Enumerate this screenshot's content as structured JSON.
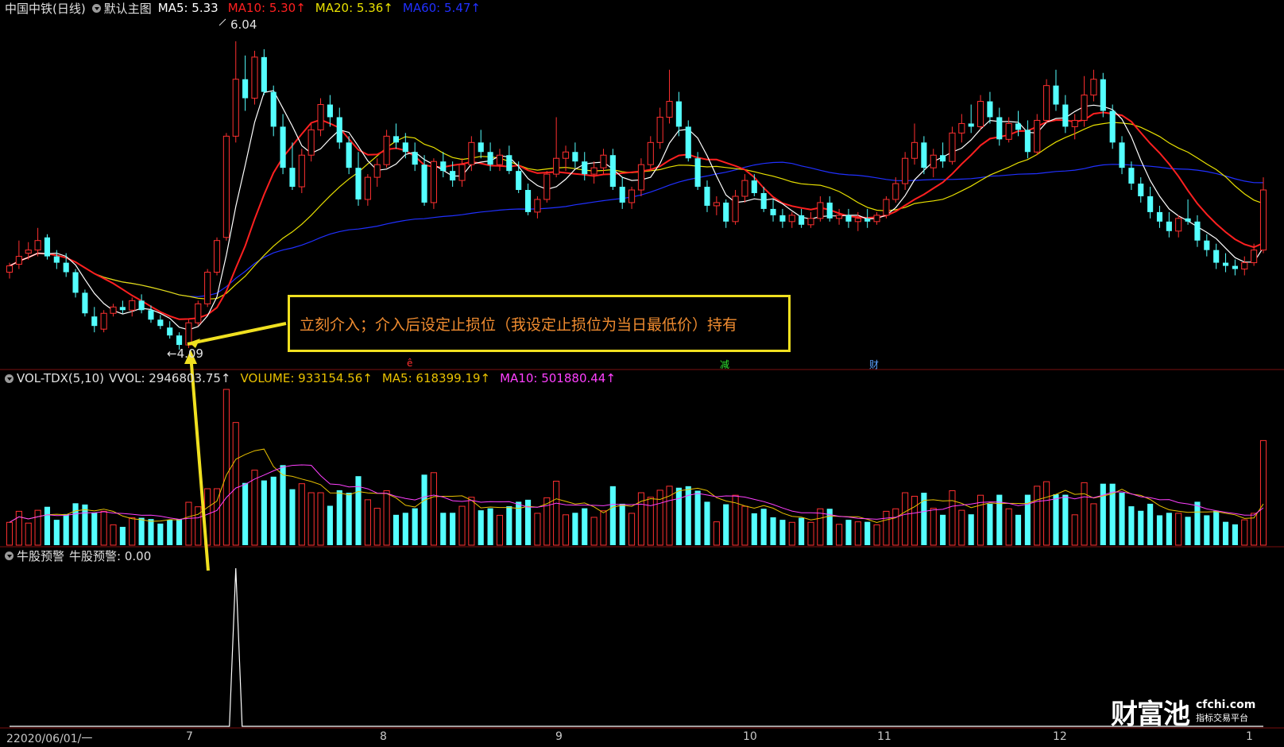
{
  "price_panel": {
    "stock_name": "中国中铁(日线)",
    "template_label": "默认主图",
    "ma5": "MA5: 5.33",
    "ma10": "MA10: 5.30↑",
    "ma20": "MA20: 5.36↑",
    "ma60": "MA60: 5.47↑",
    "high_label": "6.04",
    "low_label": "←4.09",
    "events": [
      "ê",
      "减",
      "财"
    ],
    "colors": {
      "ma5": "#ffffff",
      "ma10": "#ff2020",
      "ma20": "#e8e000",
      "ma60": "#2030ff",
      "up": "#ff3030",
      "down": "#54ffff"
    }
  },
  "callout": {
    "text": "立刻介入；介入后设定止损位（我设定止损位为当日最低价）持有",
    "border_color": "#f0e020",
    "text_color": "#f08c30"
  },
  "volume_panel": {
    "indicator": "VOL-TDX(5,10)",
    "vvol": "VVOL: 2946803.75↑",
    "volume": "VOLUME: 933154.56↑",
    "ma5": "MA5: 618399.19↑",
    "ma10": "MA10: 501880.44↑",
    "colors": {
      "vvol": "#ff3030",
      "volume": "#e8c000",
      "ma5": "#e8c000",
      "ma10": "#ff40ff"
    }
  },
  "signal_panel": {
    "indicator": "牛股预警",
    "value_label": "牛股预警: 0.00"
  },
  "x_axis": {
    "start_label": "22020/06/01/一",
    "month_ticks": [
      "7",
      "8",
      "9",
      "10",
      "11",
      "12",
      "1"
    ]
  },
  "brand": {
    "main": "财富池",
    "site": "cfchi.com",
    "tagline": "指标交易平台"
  },
  "chart_data": {
    "type": "candlestick",
    "title": "中国中铁(日线)",
    "x_ticks": [
      "7",
      "8",
      "9",
      "10",
      "11",
      "12",
      "1"
    ],
    "high": 6.04,
    "low": 4.09,
    "ohlc": [
      [
        4.58,
        4.64,
        4.54,
        4.62
      ],
      [
        4.63,
        4.78,
        4.6,
        4.68
      ],
      [
        4.7,
        4.77,
        4.66,
        4.72
      ],
      [
        4.72,
        4.86,
        4.68,
        4.78
      ],
      [
        4.8,
        4.82,
        4.66,
        4.68
      ],
      [
        4.68,
        4.72,
        4.6,
        4.64
      ],
      [
        4.64,
        4.7,
        4.55,
        4.58
      ],
      [
        4.58,
        4.6,
        4.42,
        4.45
      ],
      [
        4.45,
        4.47,
        4.3,
        4.32
      ],
      [
        4.3,
        4.36,
        4.2,
        4.24
      ],
      [
        4.22,
        4.34,
        4.2,
        4.32
      ],
      [
        4.32,
        4.38,
        4.3,
        4.36
      ],
      [
        4.36,
        4.4,
        4.32,
        4.34
      ],
      [
        4.34,
        4.42,
        4.3,
        4.4
      ],
      [
        4.4,
        4.44,
        4.32,
        4.34
      ],
      [
        4.34,
        4.37,
        4.26,
        4.28
      ],
      [
        4.28,
        4.31,
        4.22,
        4.24
      ],
      [
        4.23,
        4.27,
        4.16,
        4.18
      ],
      [
        4.18,
        4.2,
        4.09,
        4.12
      ],
      [
        4.12,
        4.28,
        4.1,
        4.26
      ],
      [
        4.26,
        4.4,
        4.24,
        4.38
      ],
      [
        4.38,
        4.6,
        4.36,
        4.58
      ],
      [
        4.58,
        4.8,
        4.56,
        4.78
      ],
      [
        4.8,
        5.46,
        4.78,
        5.44
      ],
      [
        5.44,
        6.04,
        5.4,
        5.8
      ],
      [
        5.8,
        5.95,
        5.6,
        5.68
      ],
      [
        5.68,
        5.98,
        5.64,
        5.94
      ],
      [
        5.94,
        5.99,
        5.7,
        5.72
      ],
      [
        5.72,
        5.76,
        5.44,
        5.5
      ],
      [
        5.5,
        5.58,
        5.2,
        5.24
      ],
      [
        5.24,
        5.4,
        5.1,
        5.12
      ],
      [
        5.12,
        5.36,
        5.08,
        5.32
      ],
      [
        5.32,
        5.52,
        5.28,
        5.48
      ],
      [
        5.48,
        5.68,
        5.44,
        5.64
      ],
      [
        5.64,
        5.7,
        5.5,
        5.56
      ],
      [
        5.56,
        5.62,
        5.36,
        5.4
      ],
      [
        5.4,
        5.44,
        5.2,
        5.24
      ],
      [
        5.24,
        5.34,
        5.0,
        5.04
      ],
      [
        5.04,
        5.2,
        5.0,
        5.18
      ],
      [
        5.18,
        5.3,
        5.12,
        5.26
      ],
      [
        5.26,
        5.48,
        5.24,
        5.44
      ],
      [
        5.44,
        5.52,
        5.36,
        5.4
      ],
      [
        5.4,
        5.46,
        5.3,
        5.34
      ],
      [
        5.34,
        5.4,
        5.22,
        5.26
      ],
      [
        5.26,
        5.32,
        5.0,
        5.02
      ],
      [
        5.02,
        5.3,
        4.98,
        5.28
      ],
      [
        5.28,
        5.34,
        5.18,
        5.22
      ],
      [
        5.22,
        5.28,
        5.12,
        5.16
      ],
      [
        5.16,
        5.3,
        5.12,
        5.26
      ],
      [
        5.26,
        5.44,
        5.22,
        5.4
      ],
      [
        5.4,
        5.48,
        5.3,
        5.34
      ],
      [
        5.34,
        5.4,
        5.22,
        5.26
      ],
      [
        5.26,
        5.36,
        5.22,
        5.32
      ],
      [
        5.32,
        5.38,
        5.2,
        5.22
      ],
      [
        5.22,
        5.28,
        5.08,
        5.1
      ],
      [
        5.1,
        5.14,
        4.94,
        4.96
      ],
      [
        4.96,
        5.06,
        4.92,
        5.04
      ],
      [
        5.04,
        5.22,
        5.02,
        5.2
      ],
      [
        5.2,
        5.56,
        5.18,
        5.3
      ],
      [
        5.3,
        5.38,
        5.22,
        5.34
      ],
      [
        5.34,
        5.4,
        5.24,
        5.28
      ],
      [
        5.28,
        5.34,
        5.16,
        5.2
      ],
      [
        5.2,
        5.28,
        5.14,
        5.24
      ],
      [
        5.24,
        5.36,
        5.2,
        5.32
      ],
      [
        5.32,
        5.36,
        5.1,
        5.12
      ],
      [
        5.12,
        5.18,
        4.98,
        5.02
      ],
      [
        5.02,
        5.12,
        4.98,
        5.1
      ],
      [
        5.1,
        5.3,
        5.06,
        5.26
      ],
      [
        5.26,
        5.44,
        5.22,
        5.4
      ],
      [
        5.4,
        5.62,
        5.36,
        5.56
      ],
      [
        5.56,
        5.86,
        5.52,
        5.66
      ],
      [
        5.66,
        5.72,
        5.44,
        5.5
      ],
      [
        5.5,
        5.54,
        5.28,
        5.3
      ],
      [
        5.3,
        5.34,
        5.1,
        5.12
      ],
      [
        5.12,
        5.16,
        4.96,
        5.0
      ],
      [
        5.0,
        5.06,
        4.94,
        5.02
      ],
      [
        5.02,
        5.04,
        4.86,
        4.9
      ],
      [
        4.9,
        5.1,
        4.88,
        5.06
      ],
      [
        5.06,
        5.2,
        5.02,
        5.16
      ],
      [
        5.16,
        5.2,
        5.06,
        5.08
      ],
      [
        5.08,
        5.12,
        4.96,
        4.98
      ],
      [
        4.98,
        5.04,
        4.9,
        4.94
      ],
      [
        4.94,
        4.98,
        4.86,
        4.9
      ],
      [
        4.9,
        4.96,
        4.86,
        4.94
      ],
      [
        4.94,
        4.98,
        4.86,
        4.88
      ],
      [
        4.88,
        4.96,
        4.86,
        4.92
      ],
      [
        4.92,
        5.06,
        4.9,
        5.02
      ],
      [
        5.02,
        5.06,
        4.9,
        4.92
      ],
      [
        4.92,
        4.98,
        4.88,
        4.94
      ],
      [
        4.94,
        4.98,
        4.86,
        4.9
      ],
      [
        4.9,
        4.96,
        4.84,
        4.92
      ],
      [
        4.92,
        4.98,
        4.86,
        4.9
      ],
      [
        4.9,
        4.96,
        4.88,
        4.94
      ],
      [
        4.94,
        5.06,
        4.92,
        5.04
      ],
      [
        5.04,
        5.18,
        5.02,
        5.14
      ],
      [
        5.14,
        5.34,
        5.1,
        5.3
      ],
      [
        5.3,
        5.52,
        5.26,
        5.4
      ],
      [
        5.4,
        5.44,
        5.2,
        5.24
      ],
      [
        5.24,
        5.36,
        5.18,
        5.32
      ],
      [
        5.32,
        5.4,
        5.24,
        5.28
      ],
      [
        5.28,
        5.5,
        5.26,
        5.46
      ],
      [
        5.46,
        5.58,
        5.4,
        5.52
      ],
      [
        5.52,
        5.64,
        5.46,
        5.5
      ],
      [
        5.5,
        5.7,
        5.48,
        5.66
      ],
      [
        5.66,
        5.72,
        5.52,
        5.56
      ],
      [
        5.56,
        5.62,
        5.38,
        5.42
      ],
      [
        5.42,
        5.56,
        5.4,
        5.52
      ],
      [
        5.52,
        5.6,
        5.44,
        5.48
      ],
      [
        5.48,
        5.54,
        5.3,
        5.34
      ],
      [
        5.34,
        5.58,
        5.32,
        5.54
      ],
      [
        5.54,
        5.8,
        5.52,
        5.76
      ],
      [
        5.76,
        5.86,
        5.6,
        5.64
      ],
      [
        5.64,
        5.7,
        5.46,
        5.5
      ],
      [
        5.5,
        5.58,
        5.42,
        5.54
      ],
      [
        5.54,
        5.82,
        5.5,
        5.7
      ],
      [
        5.7,
        5.86,
        5.66,
        5.8
      ],
      [
        5.8,
        5.84,
        5.56,
        5.6
      ],
      [
        5.6,
        5.64,
        5.36,
        5.4
      ],
      [
        5.4,
        5.44,
        5.2,
        5.24
      ],
      [
        5.24,
        5.28,
        5.1,
        5.14
      ],
      [
        5.14,
        5.18,
        5.02,
        5.06
      ],
      [
        5.06,
        5.12,
        4.92,
        4.96
      ],
      [
        4.96,
        5.0,
        4.86,
        4.9
      ],
      [
        4.9,
        4.96,
        4.8,
        4.84
      ],
      [
        4.84,
        4.94,
        4.8,
        4.92
      ],
      [
        4.92,
        5.04,
        4.88,
        4.9
      ],
      [
        4.9,
        4.94,
        4.74,
        4.78
      ],
      [
        4.78,
        4.82,
        4.68,
        4.72
      ],
      [
        4.72,
        4.76,
        4.6,
        4.64
      ],
      [
        4.64,
        4.7,
        4.58,
        4.62
      ],
      [
        4.62,
        4.66,
        4.56,
        4.6
      ],
      [
        4.6,
        4.68,
        4.56,
        4.64
      ],
      [
        4.64,
        4.76,
        4.62,
        4.72
      ],
      [
        4.72,
        5.18,
        4.7,
        5.1
      ]
    ]
  }
}
